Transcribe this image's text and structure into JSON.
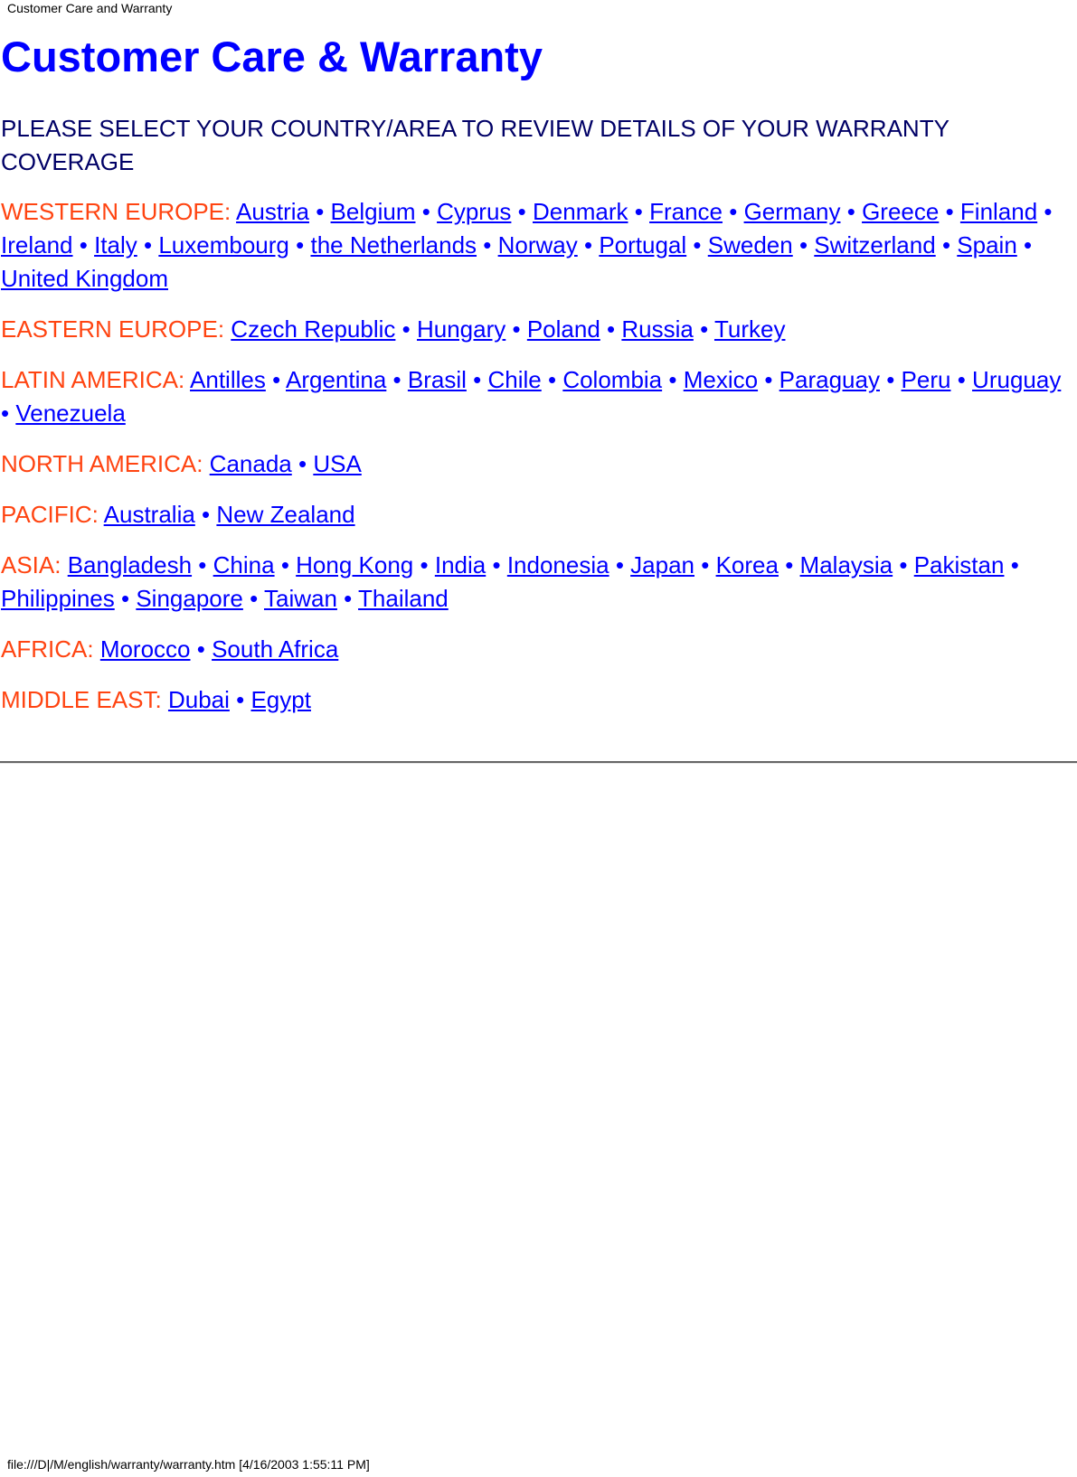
{
  "header": {
    "document_title": "Customer Care and Warranty"
  },
  "page": {
    "title": "Customer Care & Warranty",
    "intro": "PLEASE SELECT YOUR COUNTRY/AREA TO REVIEW DETAILS OF YOUR WARRANTY COVERAGE"
  },
  "regions": [
    {
      "label": "WESTERN EUROPE:",
      "countries": [
        "Austria",
        "Belgium",
        "Cyprus",
        "Denmark",
        "France",
        "Germany",
        "Greece",
        "Finland",
        "Ireland",
        "Italy",
        "Luxembourg",
        "the Netherlands",
        "Norway",
        "Portugal",
        "Sweden",
        "Switzerland",
        "Spain",
        "United Kingdom"
      ]
    },
    {
      "label": "EASTERN EUROPE:",
      "countries": [
        "Czech Republic",
        "Hungary",
        "Poland",
        "Russia",
        "Turkey"
      ]
    },
    {
      "label": "LATIN AMERICA:",
      "countries": [
        "Antilles",
        "Argentina",
        "Brasil",
        "Chile",
        "Colombia",
        "Mexico",
        "Paraguay",
        "Peru",
        "Uruguay",
        "Venezuela"
      ]
    },
    {
      "label": "NORTH AMERICA:",
      "countries": [
        "Canada",
        "USA"
      ]
    },
    {
      "label": "PACIFIC:",
      "countries": [
        "Australia",
        "New Zealand"
      ]
    },
    {
      "label": "ASIA:",
      "countries": [
        "Bangladesh",
        "China",
        "Hong Kong",
        "India",
        "Indonesia",
        "Japan",
        "Korea",
        "Malaysia",
        "Pakistan",
        "Philippines",
        "Singapore",
        "Taiwan",
        "Thailand"
      ]
    },
    {
      "label": "AFRICA:",
      "countries": [
        "Morocco",
        "South Africa"
      ]
    },
    {
      "label": "MIDDLE EAST:",
      "countries": [
        "Dubai",
        "Egypt"
      ]
    }
  ],
  "separator": "•",
  "footer": {
    "file_path": "file:///D|/M/english/warranty/warranty.htm [4/16/2003 1:55:11 PM]"
  },
  "colors": {
    "title": "#0000ff",
    "intro": "#000066",
    "region_label": "#ff4411",
    "link": "#0000ff"
  }
}
